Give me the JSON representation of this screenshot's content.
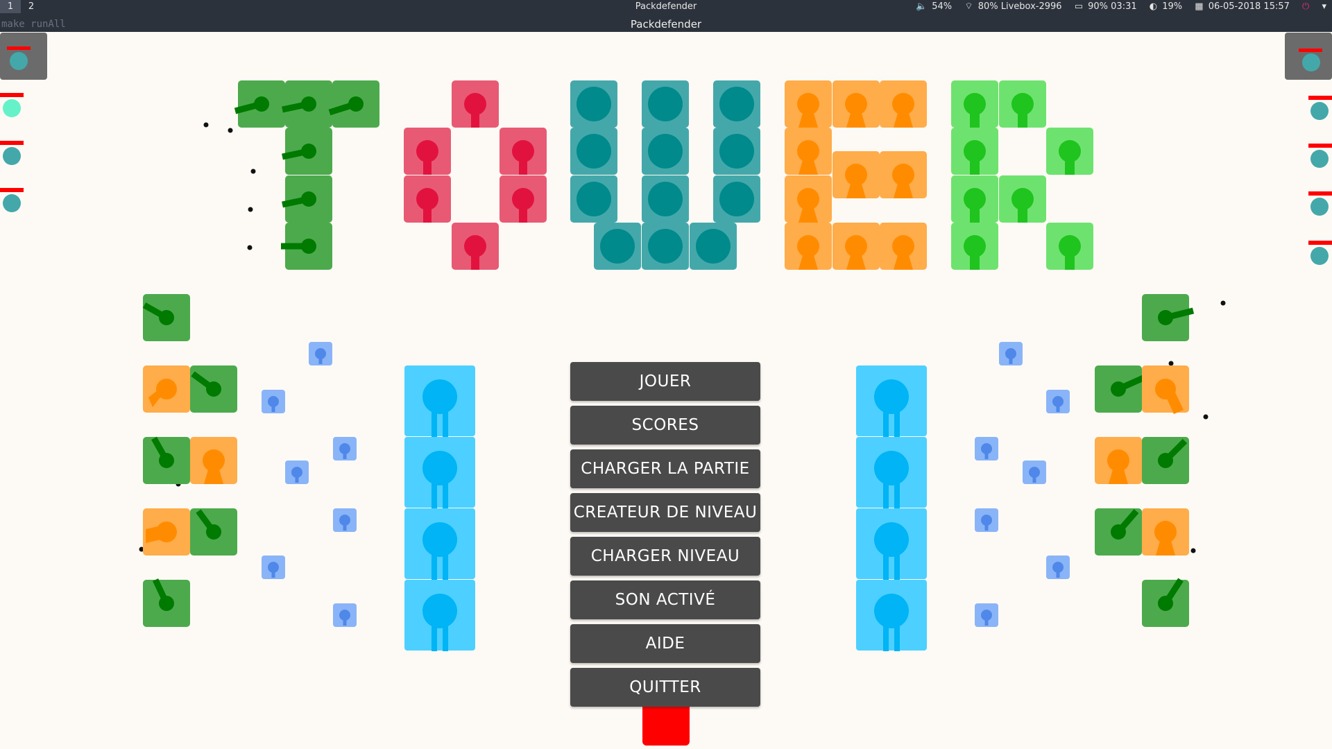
{
  "topbar": {
    "workspaces": [
      "1",
      "2"
    ],
    "title": "Packdefender",
    "status": {
      "volume": "54%",
      "wifi": "80% Livebox-2996",
      "battery": "90% 03:31",
      "brightness": "19%",
      "datetime": "06-05-2018 15:57"
    }
  },
  "window": {
    "title": "Packdefender",
    "command": "make runAll"
  },
  "logo": {
    "text": "TOWER",
    "colors": {
      "T": "#4caa4c",
      "O": "#e85a74",
      "W": "#44a8aa",
      "E": "#ffac4a",
      "R": "#6ee26e"
    }
  },
  "menu": {
    "items": [
      "JOUER",
      "SCORES",
      "CHARGER LA PARTIE",
      "CREATEUR DE NIVEAU",
      "CHARGER NIVEAU",
      "SON ACTIVÉ",
      "AIDE",
      "QUITTER"
    ]
  },
  "colors": {
    "background": "#fdfaf5",
    "menu_button": "#4b4a4a",
    "tower_green": "#4caa4c",
    "tower_orange": "#ffac4a",
    "path_blue": "#4dd0ff",
    "enemy_blue": "#8ab4f8",
    "quit_red": "#ff0000",
    "panel_gray": "#6b6b6b"
  },
  "icons": {
    "volume": "speaker-icon",
    "wifi": "wifi-icon",
    "battery": "battery-icon",
    "brightness": "brightness-icon",
    "calendar": "calendar-icon",
    "power": "power-icon"
  }
}
